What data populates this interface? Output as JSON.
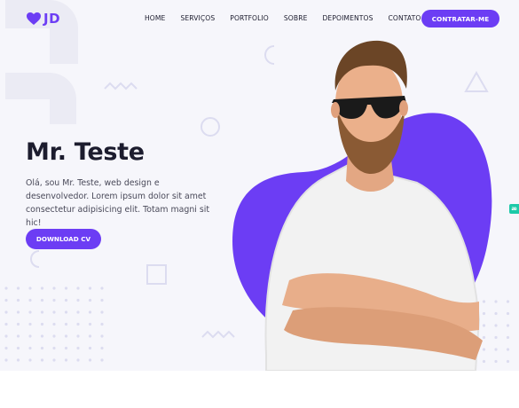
{
  "brand": {
    "name": "JD",
    "color": "#6c3df4"
  },
  "nav": {
    "items": [
      "HOME",
      "SERVIÇOS",
      "PORTFOLIO",
      "SOBRE",
      "DEPOIMENTOS",
      "CONTATO"
    ],
    "cta_label": "CONTRATAR-ME"
  },
  "hero": {
    "title": "Mr. Teste",
    "description": "Olá, sou Mr. Teste, web design e desenvolvedor. Lorem ipsum dolor sit amet consectetur adipisicing elit. Totam magni sit hic!",
    "cta_label": "DOWNLOAD CV",
    "photo_alt": "Man with beard and sunglasses, arms crossed"
  },
  "side_widget": {
    "label": "æ",
    "color": "#1dc9a8"
  },
  "colors": {
    "accent": "#6c3df4",
    "background": "#f6f6fb",
    "text": "#1c1c2e",
    "decor": "#dcdcf0"
  }
}
